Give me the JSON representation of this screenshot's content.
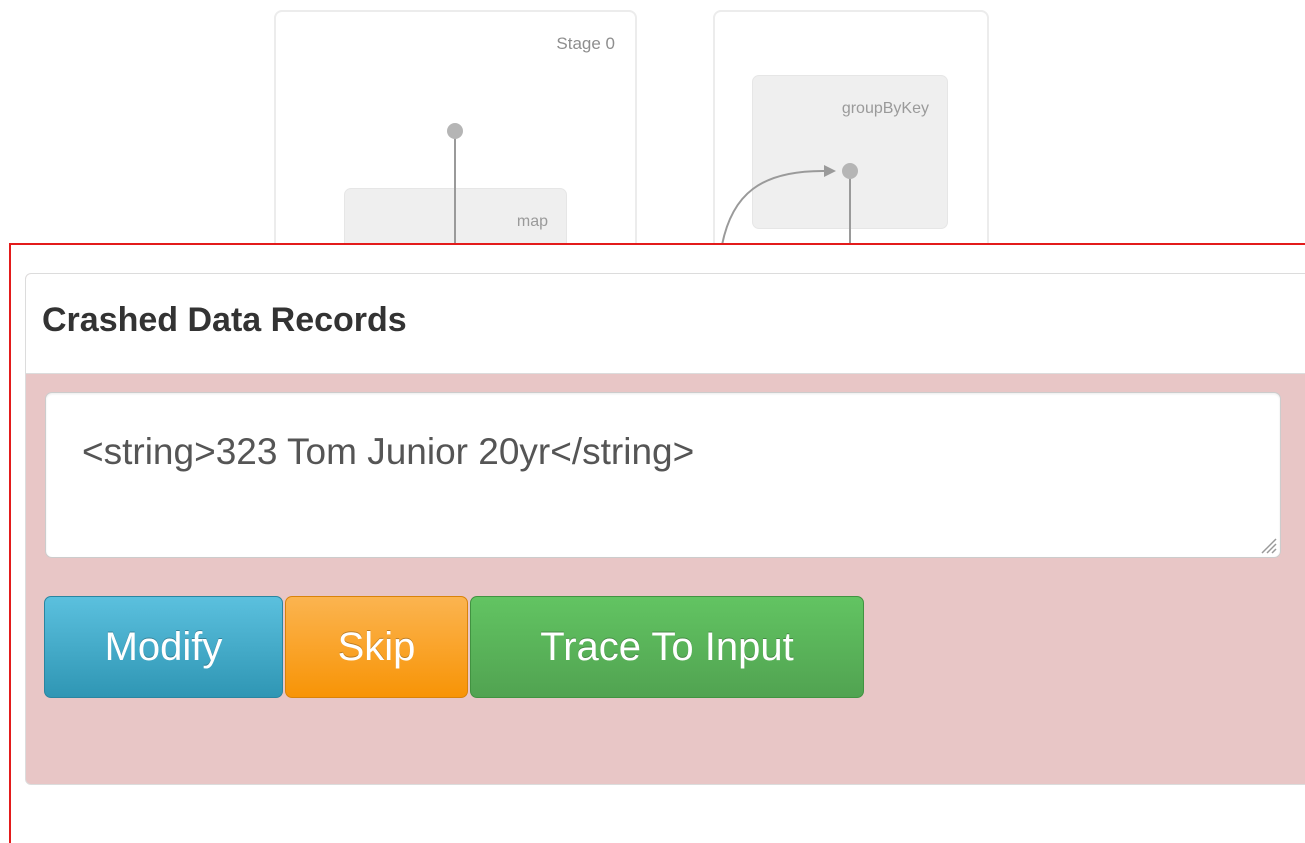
{
  "dag": {
    "stages": [
      {
        "title": "Stage 0",
        "operator": "map"
      },
      {
        "title": "",
        "operator": "groupByKey"
      }
    ]
  },
  "panel": {
    "title": "Crashed Data Records",
    "record_value": "<string>323 Tom Junior 20yr</string>",
    "buttons": {
      "modify": "Modify",
      "skip": "Skip",
      "trace": "Trace To Input"
    }
  },
  "colors": {
    "panel_bg": "#e8c6c6",
    "frame_red": "#e31b1b",
    "modify": "#2f96b4",
    "skip": "#f89406",
    "trace": "#51a351"
  }
}
